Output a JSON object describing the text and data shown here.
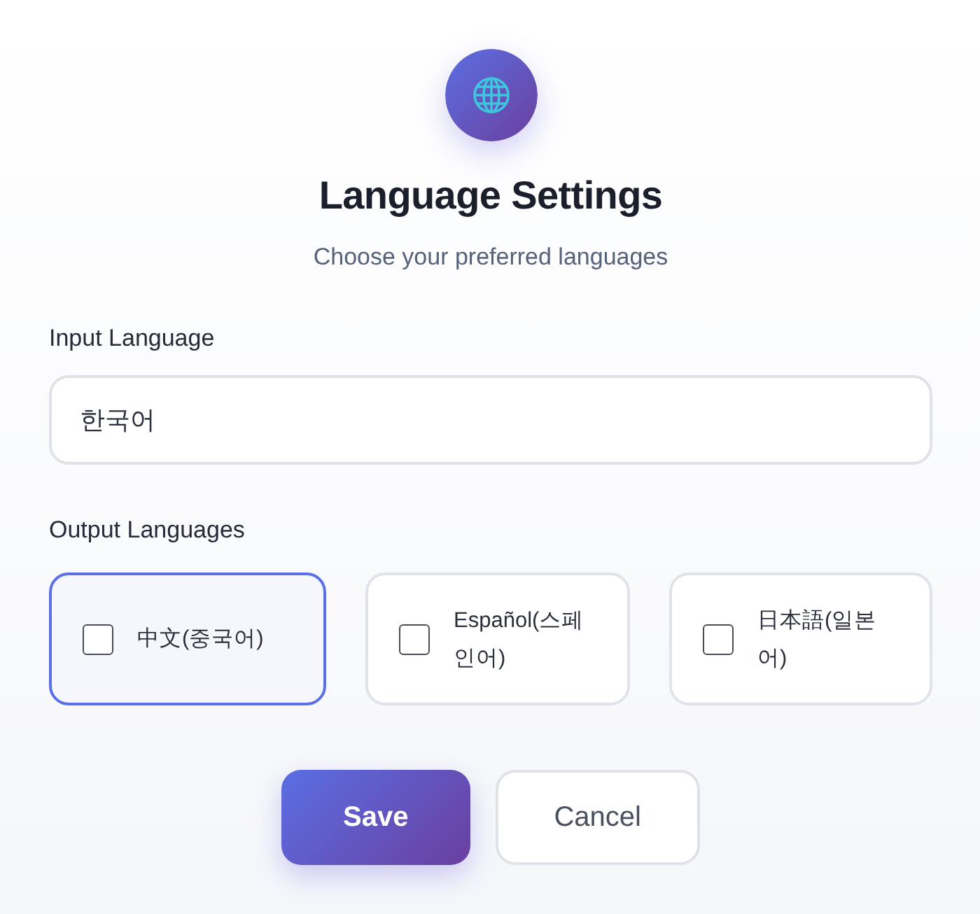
{
  "header": {
    "title": "Language Settings",
    "subtitle": "Choose your preferred languages"
  },
  "input_language": {
    "label": "Input Language",
    "value": "한국어"
  },
  "output_languages": {
    "label": "Output Languages",
    "options": [
      {
        "label": "中文(중국어)",
        "checked": false,
        "focused": true
      },
      {
        "label": "Español(스페인어)",
        "checked": false,
        "focused": false
      },
      {
        "label": "日本語(일본어)",
        "checked": false,
        "focused": false
      }
    ]
  },
  "buttons": [
    {
      "label": "Save",
      "kind": "primary"
    },
    {
      "label": "Cancel",
      "kind": "secondary"
    }
  ]
}
